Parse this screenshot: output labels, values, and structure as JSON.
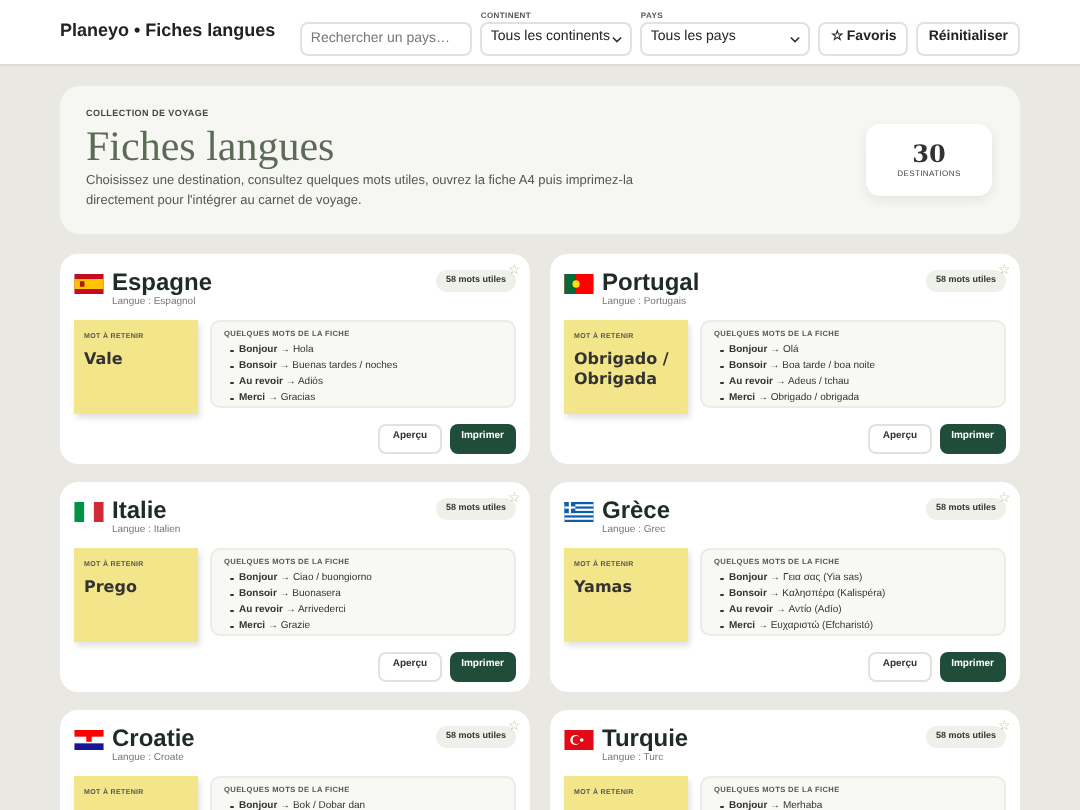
{
  "header": {
    "title": "Planeyo • Fiches langues",
    "search": {
      "placeholder": "Rechercher un pays…"
    },
    "filters": [
      {
        "label": "CONTINENT",
        "value": "Tous les continents"
      },
      {
        "label": "PAYS",
        "value": "Tous les pays"
      }
    ],
    "favorites_button": {
      "icon": "☆",
      "label": "Favoris"
    },
    "reset_button": "Réinitialiser"
  },
  "hero": {
    "eyebrow": "COLLECTION DE VOYAGE",
    "title": "Fiches langues",
    "description": "Choisissez une destination, consultez quelques mots utiles, ouvrez la fiche A4 puis imprimez-la directement pour l'intégrer au carnet de voyage.",
    "count": "30",
    "count_label": "DESTINATIONS"
  },
  "cards": [
    {
      "kind": "es",
      "country": "Espagne",
      "language": "Langue : Espagnol",
      "badge": "58 mots utiles",
      "favorite": false,
      "note_label": "MOT À RETENIR",
      "note_word": "Vale",
      "words_title": "QUELQUES MOTS DE LA FICHE",
      "words": [
        "**Bonjour** → Hola",
        "**Bonsoir** → Buenas tardes / noches",
        "**Au revoir** → Adiós",
        "**Merci** → Gracias"
      ],
      "buttons": [
        "Aperçu",
        "Imprimer"
      ]
    },
    {
      "kind": "pt",
      "country": "Portugal",
      "language": "Langue : Portugais",
      "badge": "58 mots utiles",
      "favorite": false,
      "note_label": "MOT À RETENIR",
      "note_word": "Obrigado / Obrigada",
      "words_title": "QUELQUES MOTS DE LA FICHE",
      "words": [
        "**Bonjour** → Olá",
        "**Bonsoir** → Boa tarde / boa noite",
        "**Au revoir** → Adeus / tchau",
        "**Merci** → Obrigado / obrigada"
      ],
      "buttons": [
        "Aperçu",
        "Imprimer"
      ]
    },
    {
      "kind": "it",
      "country": "Italie",
      "language": "Langue : Italien",
      "badge": "58 mots utiles",
      "favorite": false,
      "note_label": "MOT À RETENIR",
      "note_word": "Prego",
      "words_title": "QUELQUES MOTS DE LA FICHE",
      "words": [
        "**Bonjour** → Ciao / buongiorno",
        "**Bonsoir** → Buonasera",
        "**Au revoir** → Arrivederci",
        "**Merci** → Grazie"
      ],
      "buttons": [
        "Aperçu",
        "Imprimer"
      ]
    },
    {
      "kind": "gr",
      "country": "Grèce",
      "language": "Langue : Grec",
      "badge": "58 mots utiles",
      "favorite": false,
      "note_label": "MOT À RETENIR",
      "note_word": "Yamas",
      "words_title": "QUELQUES MOTS DE LA FICHE",
      "words": [
        "**Bonjour** → Γεια σας (Yia sas)",
        "**Bonsoir** → Καλησπέρα (Kalispéra)",
        "**Au revoir** → Αντίο (Adío)",
        "**Merci** → Ευχαριστώ (Efcharistó)"
      ],
      "buttons": [
        "Aperçu",
        "Imprimer"
      ]
    },
    {
      "kind": "hr",
      "country": "Croatie",
      "language": "Langue : Croate",
      "badge": "58 mots utiles",
      "favorite": false,
      "note_label": "MOT À RETENIR",
      "words_title": "QUELQUES MOTS DE LA FICHE",
      "words": [
        "**Bonjour** → Bok / Dobar dan"
      ]
    },
    {
      "kind": "tr",
      "country": "Turquie",
      "language": "Langue : Turc",
      "badge": "58 mots utiles",
      "favorite": false,
      "note_label": "MOT À RETENIR",
      "words_title": "QUELQUES MOTS DE LA FICHE",
      "words": [
        "**Bonjour** → Merhaba"
      ]
    }
  ]
}
